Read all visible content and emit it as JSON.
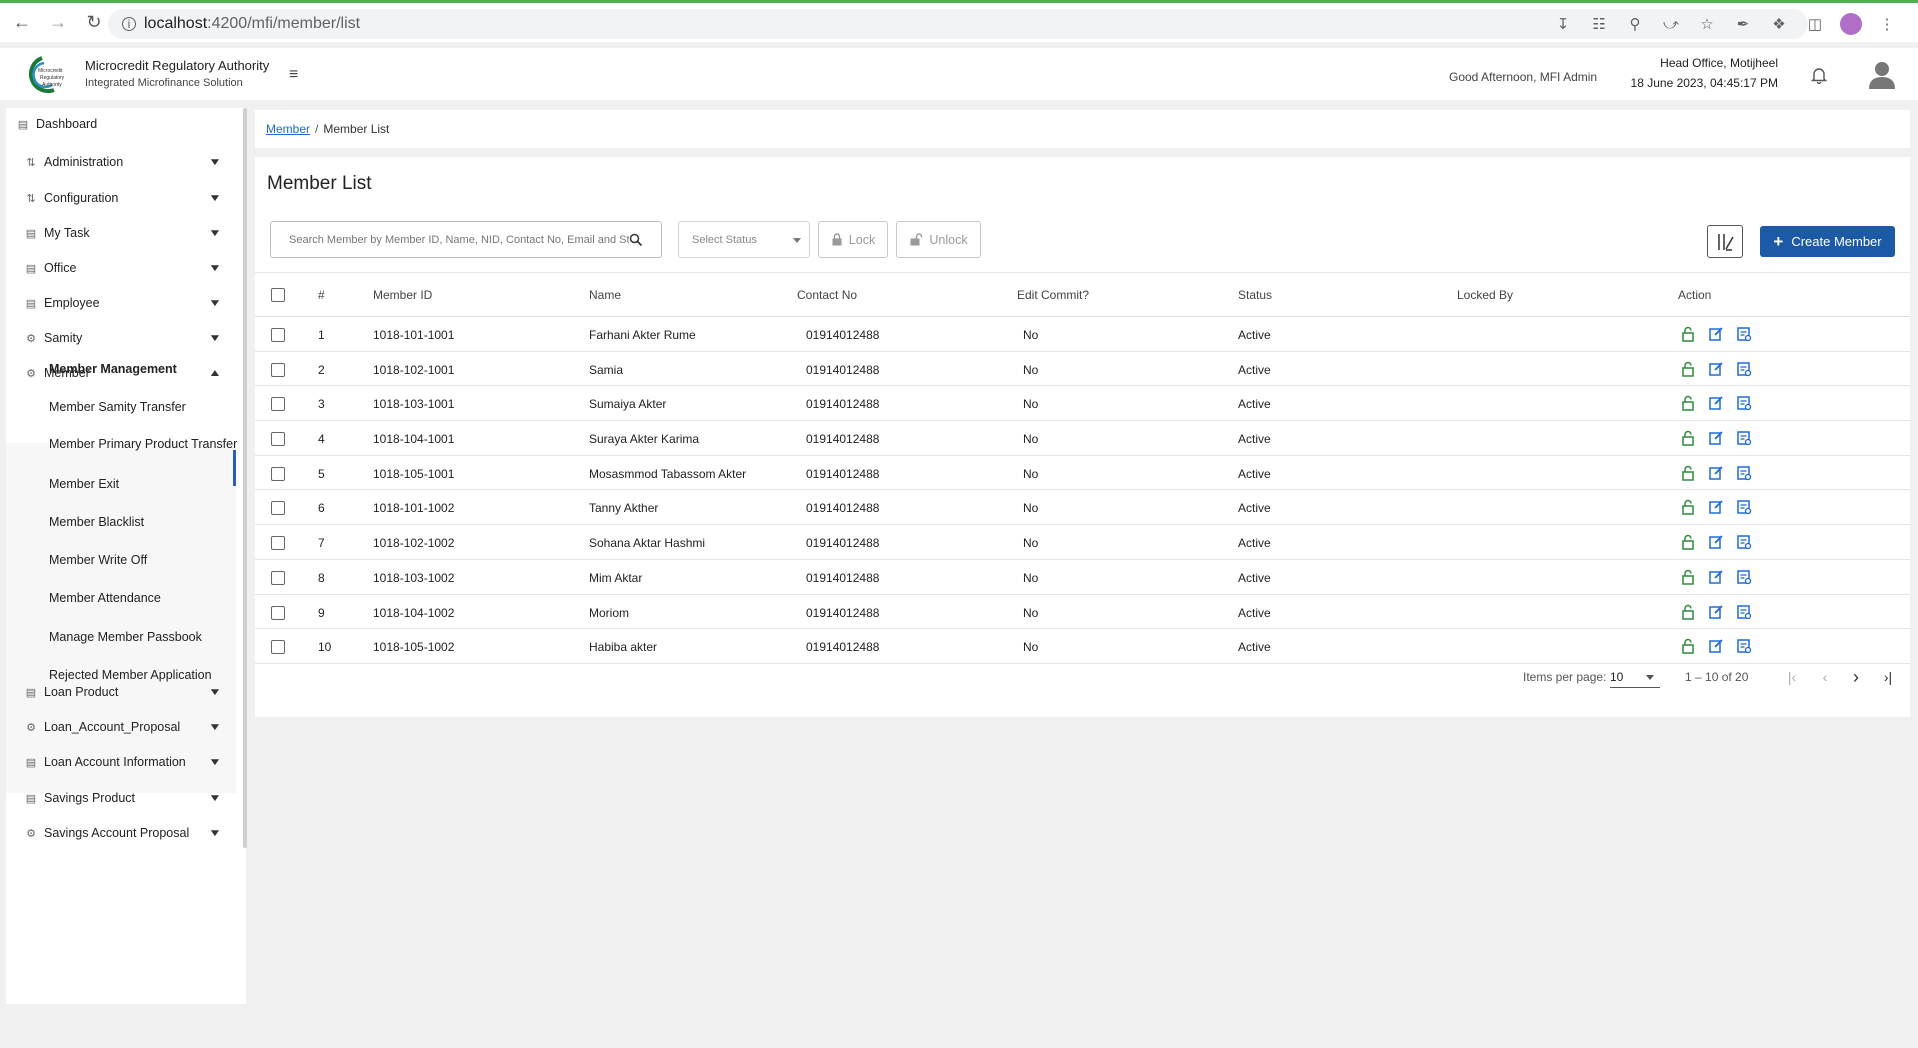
{
  "browser": {
    "url_host": "localhost",
    "url_path": ":4200/mfi/member/list"
  },
  "header": {
    "org_name": "Microcredit Regulatory Authority",
    "org_subtitle": "Integrated Microfinance Solution",
    "greeting": "Good Afternoon, MFI Admin",
    "office": "Head Office, Motijheel",
    "datetime": "18 June 2023, 04:45:17 PM"
  },
  "sidebar": {
    "items": [
      {
        "label": "Dashboard",
        "icon": "dashboard-icon",
        "expandable": false
      },
      {
        "label": "Administration",
        "icon": "sliders-icon",
        "expandable": true
      },
      {
        "label": "Configuration",
        "icon": "sliders-icon",
        "expandable": true
      },
      {
        "label": "My Task",
        "icon": "task-icon",
        "expandable": true
      },
      {
        "label": "Office",
        "icon": "office-icon",
        "expandable": true
      },
      {
        "label": "Employee",
        "icon": "employee-icon",
        "expandable": true
      },
      {
        "label": "Samity",
        "icon": "samity-icon",
        "expandable": true
      },
      {
        "label": "Member",
        "icon": "member-icon",
        "expandable": true,
        "expanded": true
      },
      {
        "label": "Loan Product",
        "icon": "product-icon",
        "expandable": true
      },
      {
        "label": "Loan_Account_Proposal",
        "icon": "proposal-icon",
        "expandable": true
      },
      {
        "label": "Loan Account Information",
        "icon": "info-icon",
        "expandable": true
      },
      {
        "label": "Savings Product",
        "icon": "product-icon",
        "expandable": true
      },
      {
        "label": "Savings Account Proposal",
        "icon": "proposal-icon",
        "expandable": true
      }
    ],
    "member_subitems": [
      {
        "label": "Member Management",
        "active": true
      },
      {
        "label": "Member Samity Transfer"
      },
      {
        "label": "Member Primary Product Transfer"
      },
      {
        "label": "Member Exit"
      },
      {
        "label": "Member Blacklist"
      },
      {
        "label": "Member Write Off"
      },
      {
        "label": "Member Attendance"
      },
      {
        "label": "Manage Member Passbook"
      },
      {
        "label": "Rejected Member Application"
      }
    ]
  },
  "breadcrumb": {
    "parent": "Member",
    "separator": "/",
    "current": "Member List"
  },
  "main": {
    "title": "Member List",
    "search_placeholder": "Search Member by Member ID, Name, NID, Contact No, Email and Status",
    "status_placeholder": "Select Status",
    "lock_label": "Lock",
    "unlock_label": "Unlock",
    "create_label": "Create Member"
  },
  "table": {
    "headers": [
      "#",
      "Member ID",
      "Name",
      "Contact No",
      "Edit Commit?",
      "Status",
      "Locked By",
      "Action"
    ],
    "rows": [
      [
        "1",
        "1018-101-1001",
        "Farhani Akter Rume",
        "01914012488",
        "No",
        "Active",
        ""
      ],
      [
        "2",
        "1018-102-1001",
        "Samia",
        "01914012488",
        "No",
        "Active",
        ""
      ],
      [
        "3",
        "1018-103-1001",
        "Sumaiya Akter",
        "01914012488",
        "No",
        "Active",
        ""
      ],
      [
        "4",
        "1018-104-1001",
        "Suraya Akter Karima",
        "01914012488",
        "No",
        "Active",
        ""
      ],
      [
        "5",
        "1018-105-1001",
        "Mosasmmod Tabassom Akter",
        "01914012488",
        "No",
        "Active",
        ""
      ],
      [
        "6",
        "1018-101-1002",
        "Tanny Akther",
        "01914012488",
        "No",
        "Active",
        ""
      ],
      [
        "7",
        "1018-102-1002",
        "Sohana Aktar Hashmi",
        "01914012488",
        "No",
        "Active",
        ""
      ],
      [
        "8",
        "1018-103-1002",
        "Mim Aktar",
        "01914012488",
        "No",
        "Active",
        ""
      ],
      [
        "9",
        "1018-104-1002",
        "Moriom",
        "01914012488",
        "No",
        "Active",
        ""
      ],
      [
        "10",
        "1018-105-1002",
        "Habiba akter",
        "01914012488",
        "No",
        "Active",
        ""
      ]
    ]
  },
  "paginator": {
    "items_per_page_label": "Items per page:",
    "page_size": "10",
    "range_label": "1 – 10 of 20"
  },
  "colors": {
    "primary": "#1c5aa8",
    "action_green": "#2e8b3e",
    "action_blue": "#1e6bd6",
    "active_bar": "#2b5fb3"
  }
}
